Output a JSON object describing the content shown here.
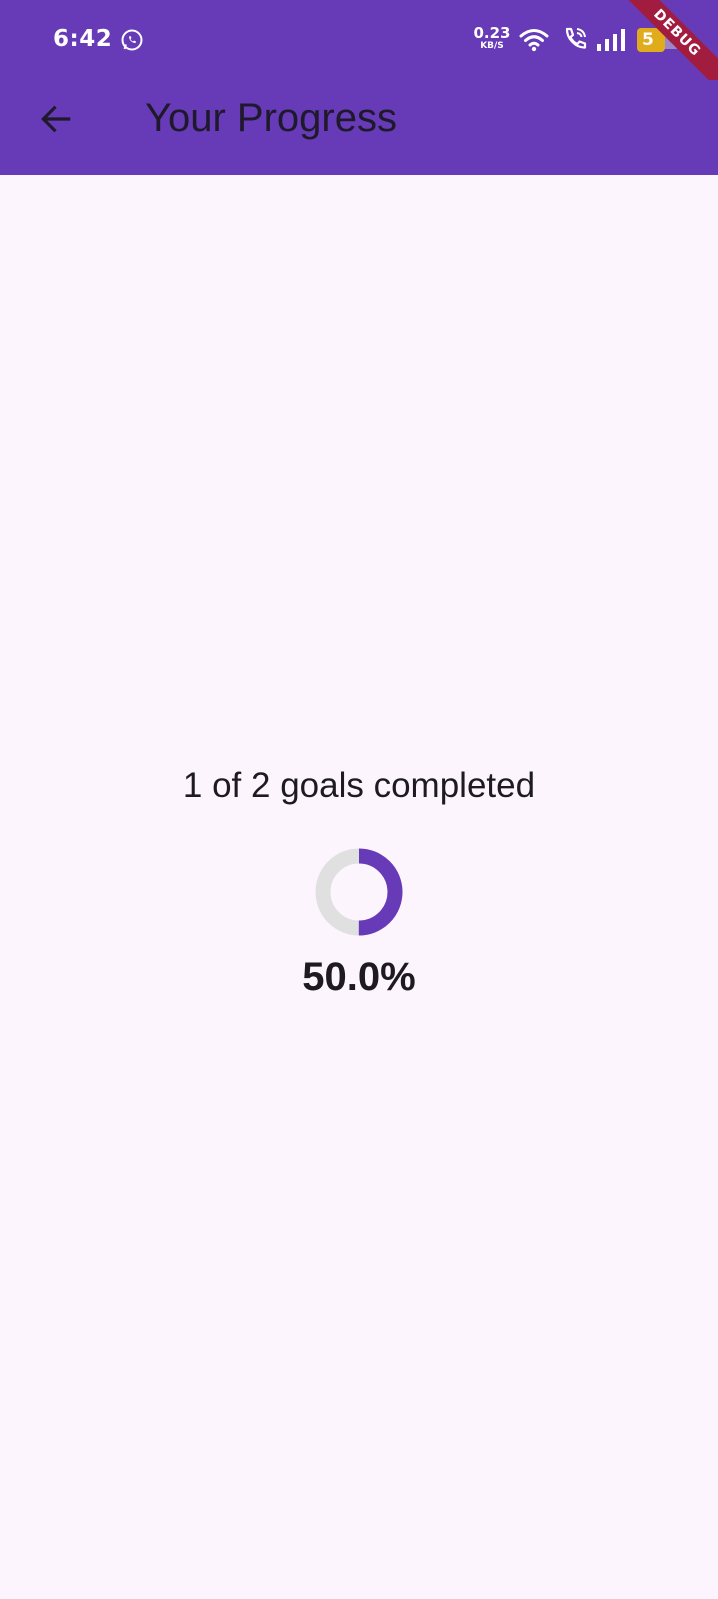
{
  "status_bar": {
    "time": "6:42",
    "net_speed_value": "0.23",
    "net_speed_unit": "KB/S",
    "battery_level": "5",
    "icons": [
      "whatsapp-icon",
      "wifi-icon",
      "call-icon",
      "signal-icon",
      "battery-icon"
    ]
  },
  "debug_banner": "DEBUG",
  "app_bar": {
    "title": "Your Progress",
    "back_icon": "arrow-back-icon"
  },
  "progress": {
    "summary": "1 of 2 goals completed",
    "fraction": 0.5,
    "percent_label": "50.0%"
  },
  "colors": {
    "primary": "#673ab7",
    "background": "#fcf5fd",
    "track": "#e0e0e0",
    "text": "#1d1b20",
    "debug_banner": "#a21c3f",
    "battery": "#e0ac1c"
  }
}
